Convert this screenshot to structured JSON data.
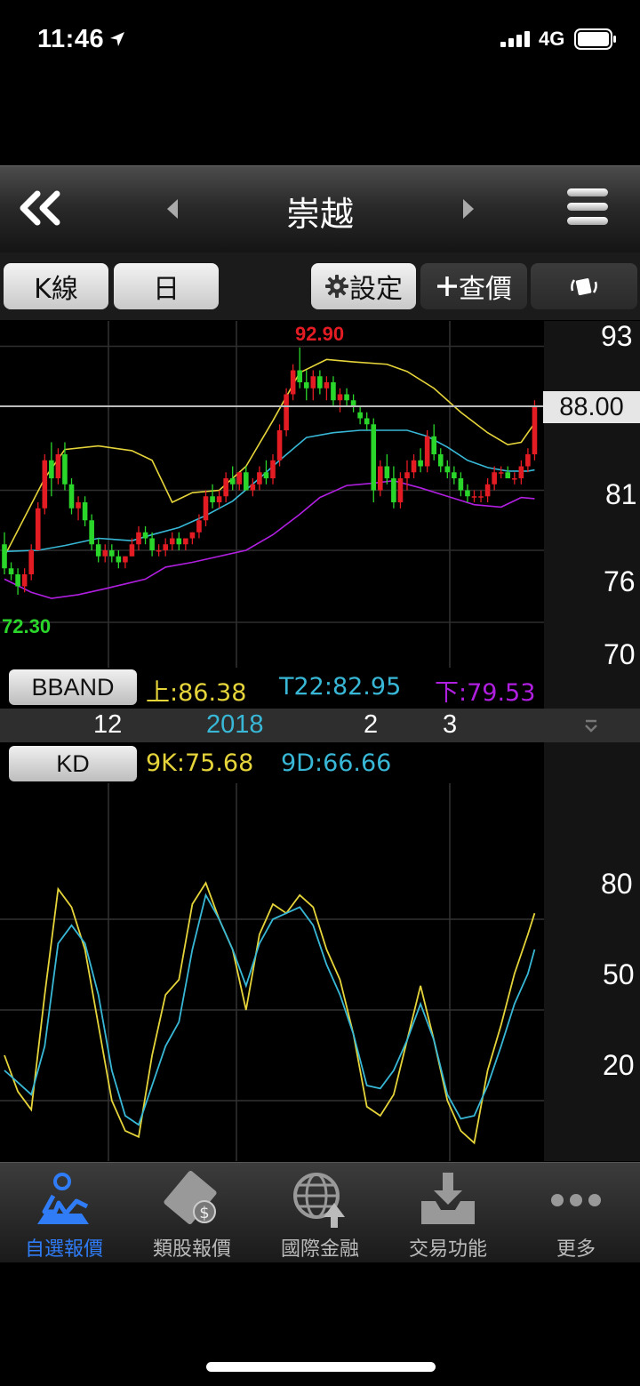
{
  "status": {
    "time": "11:46",
    "network": "4G"
  },
  "nav": {
    "title": "崇越"
  },
  "toolbar": {
    "k_line": "K線",
    "period": "日",
    "settings": "設定",
    "lookup": "查價"
  },
  "price_axis": {
    "ticks": [
      "93",
      "81",
      "76",
      "70"
    ],
    "current": "88.00"
  },
  "kd_axis": {
    "ticks": [
      "80",
      "50",
      "20"
    ]
  },
  "chart_labels": {
    "high": "92.90",
    "low": "72.30"
  },
  "bband": {
    "name": "BBAND",
    "upper": "上:86.38",
    "mid": "T22:82.95",
    "lower": "下:79.53"
  },
  "kd": {
    "name": "KD",
    "k": "9K:75.68",
    "d": "9D:66.66"
  },
  "dates": {
    "d1": "12",
    "d2": "2018",
    "d3": "2",
    "d4": "3"
  },
  "tabs": [
    {
      "label": "自選報價",
      "icon": "watchlist-icon",
      "active": true
    },
    {
      "label": "類股報價",
      "icon": "film-dollar-icon"
    },
    {
      "label": "國際金融",
      "icon": "globe-icon"
    },
    {
      "label": "交易功能",
      "icon": "download-tray-icon"
    },
    {
      "label": "更多",
      "icon": "more-dots-icon"
    }
  ],
  "colors": {
    "up": "#e31c23",
    "down": "#2bd62b",
    "upper_band": "#e5d43a",
    "mid_band": "#38b8d6",
    "lower_band": "#b01fe0",
    "k_line": "#e5d43a",
    "d_line": "#38b8d6",
    "active_tab": "#2f7cf6"
  },
  "chart_data": [
    {
      "type": "candlestick",
      "title": "",
      "y_ticks": [
        70,
        76,
        81,
        93
      ],
      "ylim": [
        69,
        94
      ],
      "x_ticks": [
        "12",
        "2018",
        "2",
        "3"
      ],
      "annotations": {
        "high": 92.9,
        "low": 72.3,
        "last": 88.0
      },
      "ohlc": [
        [
          76.5,
          77.5,
          74.0,
          74.5
        ],
        [
          74.5,
          75.0,
          73.5,
          74.0
        ],
        [
          74.0,
          74.5,
          72.3,
          73.0
        ],
        [
          73.0,
          74.5,
          72.5,
          74.0
        ],
        [
          74.0,
          76.5,
          73.5,
          76.0
        ],
        [
          76.0,
          80.0,
          76.0,
          79.5
        ],
        [
          79.5,
          84.0,
          79.0,
          83.5
        ],
        [
          83.5,
          85.0,
          80.5,
          82.0
        ],
        [
          82.0,
          84.5,
          81.5,
          84.0
        ],
        [
          84.0,
          85.0,
          81.0,
          81.5
        ],
        [
          81.5,
          82.0,
          79.0,
          79.5
        ],
        [
          79.5,
          80.5,
          78.5,
          80.0
        ],
        [
          80.0,
          80.5,
          78.0,
          78.5
        ],
        [
          78.5,
          79.0,
          76.0,
          76.5
        ],
        [
          76.5,
          77.0,
          75.0,
          75.5
        ],
        [
          75.5,
          76.5,
          75.0,
          76.0
        ],
        [
          76.0,
          76.5,
          75.0,
          75.5
        ],
        [
          75.5,
          76.0,
          74.5,
          75.0
        ],
        [
          75.0,
          75.5,
          74.5,
          75.5
        ],
        [
          75.5,
          77.0,
          75.5,
          76.5
        ],
        [
          76.5,
          78.0,
          76.0,
          77.5
        ],
        [
          77.5,
          78.0,
          76.5,
          77.0
        ],
        [
          77.0,
          77.5,
          75.5,
          76.0
        ],
        [
          76.0,
          76.5,
          75.5,
          76.0
        ],
        [
          76.0,
          77.0,
          75.5,
          76.5
        ],
        [
          76.5,
          77.5,
          76.0,
          77.0
        ],
        [
          77.0,
          77.5,
          76.0,
          76.5
        ],
        [
          76.5,
          77.0,
          76.0,
          77.0
        ],
        [
          77.0,
          77.5,
          76.5,
          77.5
        ],
        [
          77.5,
          79.0,
          77.0,
          78.5
        ],
        [
          78.5,
          81.0,
          78.0,
          80.5
        ],
        [
          80.5,
          81.5,
          79.5,
          80.0
        ],
        [
          80.0,
          81.0,
          79.5,
          80.5
        ],
        [
          80.5,
          82.5,
          80.0,
          82.0
        ],
        [
          82.0,
          83.0,
          81.0,
          81.5
        ],
        [
          81.5,
          82.5,
          81.0,
          82.5
        ],
        [
          82.5,
          83.0,
          81.0,
          81.0
        ],
        [
          81.0,
          82.0,
          80.5,
          81.5
        ],
        [
          81.5,
          83.0,
          81.0,
          82.5
        ],
        [
          82.5,
          83.5,
          81.5,
          82.0
        ],
        [
          82.0,
          84.0,
          81.5,
          83.5
        ],
        [
          83.5,
          86.5,
          83.0,
          86.0
        ],
        [
          86.0,
          89.5,
          85.5,
          89.0
        ],
        [
          89.0,
          91.5,
          88.5,
          91.0
        ],
        [
          91.0,
          92.9,
          89.5,
          90.0
        ],
        [
          90.0,
          91.0,
          88.5,
          89.5
        ],
        [
          89.5,
          91.0,
          88.5,
          90.5
        ],
        [
          90.5,
          91.0,
          89.0,
          89.5
        ],
        [
          89.5,
          90.5,
          88.5,
          90.0
        ],
        [
          90.0,
          90.5,
          88.0,
          88.5
        ],
        [
          88.5,
          89.5,
          87.5,
          89.0
        ],
        [
          89.0,
          89.5,
          88.0,
          88.5
        ],
        [
          88.5,
          89.0,
          87.5,
          88.0
        ],
        [
          87.5,
          88.0,
          86.5,
          87.0
        ],
        [
          87.0,
          87.5,
          86.0,
          86.5
        ],
        [
          86.5,
          87.0,
          80.0,
          81.0
        ],
        [
          81.0,
          83.5,
          80.5,
          83.0
        ],
        [
          83.0,
          84.0,
          81.5,
          82.0
        ],
        [
          82.0,
          83.0,
          79.5,
          80.0
        ],
        [
          80.0,
          82.5,
          79.5,
          82.0
        ],
        [
          82.0,
          83.5,
          81.0,
          82.5
        ],
        [
          82.5,
          84.0,
          82.0,
          83.5
        ],
        [
          83.5,
          84.5,
          82.5,
          83.0
        ],
        [
          83.0,
          86.0,
          82.5,
          85.5
        ],
        [
          85.5,
          86.5,
          83.5,
          84.0
        ],
        [
          84.0,
          84.5,
          82.5,
          83.0
        ],
        [
          83.0,
          83.5,
          82.0,
          82.5
        ],
        [
          82.5,
          83.0,
          81.5,
          82.0
        ],
        [
          82.0,
          82.5,
          80.5,
          81.0
        ],
        [
          81.0,
          81.5,
          80.0,
          80.5
        ],
        [
          80.5,
          81.0,
          80.0,
          80.5
        ],
        [
          80.5,
          81.0,
          80.0,
          80.5
        ],
        [
          80.5,
          82.0,
          80.0,
          81.5
        ],
        [
          81.5,
          83.0,
          81.0,
          82.5
        ],
        [
          82.5,
          83.0,
          82.0,
          82.5
        ],
        [
          82.5,
          83.0,
          82.0,
          82.0
        ],
        [
          82.0,
          82.5,
          81.5,
          82.0
        ],
        [
          82.0,
          83.5,
          81.5,
          83.0
        ],
        [
          83.0,
          84.5,
          82.5,
          84.0
        ],
        [
          84.0,
          88.5,
          83.5,
          88.0
        ]
      ],
      "bands": {
        "upper": [
          [
            0,
            75.5
          ],
          [
            6,
            82.0
          ],
          [
            9,
            84.4
          ],
          [
            14,
            84.7
          ],
          [
            19,
            84.3
          ],
          [
            22,
            83.5
          ],
          [
            25,
            80.0
          ],
          [
            28,
            80.8
          ],
          [
            32,
            81.0
          ],
          [
            36,
            83.0
          ],
          [
            40,
            86.8
          ],
          [
            44,
            90.8
          ],
          [
            48,
            91.9
          ],
          [
            52,
            91.7
          ],
          [
            57,
            91.5
          ],
          [
            60,
            90.9
          ],
          [
            64,
            89.5
          ],
          [
            68,
            87.5
          ],
          [
            72,
            85.8
          ],
          [
            75,
            84.8
          ],
          [
            77,
            85.0
          ],
          [
            79,
            86.6
          ]
        ],
        "mid": [
          [
            0,
            75.9
          ],
          [
            5,
            76.0
          ],
          [
            9,
            76.4
          ],
          [
            14,
            77.0
          ],
          [
            19,
            76.8
          ],
          [
            22,
            77.3
          ],
          [
            26,
            77.9
          ],
          [
            30,
            78.9
          ],
          [
            34,
            80.1
          ],
          [
            38,
            82.0
          ],
          [
            41,
            83.5
          ],
          [
            45,
            85.4
          ],
          [
            49,
            85.8
          ],
          [
            53,
            86.0
          ],
          [
            57,
            86.0
          ],
          [
            60,
            86.0
          ],
          [
            63,
            85.5
          ],
          [
            66,
            84.6
          ],
          [
            69,
            83.5
          ],
          [
            72,
            82.9
          ],
          [
            75,
            82.6
          ],
          [
            78,
            82.6
          ],
          [
            79,
            82.7
          ]
        ],
        "lower": [
          [
            0,
            73.6
          ],
          [
            4,
            72.5
          ],
          [
            7,
            72.0
          ],
          [
            11,
            72.3
          ],
          [
            15,
            72.8
          ],
          [
            18,
            73.2
          ],
          [
            21,
            73.6
          ],
          [
            24,
            74.6
          ],
          [
            28,
            75.0
          ],
          [
            32,
            75.5
          ],
          [
            36,
            76.0
          ],
          [
            40,
            77.3
          ],
          [
            44,
            79.0
          ],
          [
            47,
            80.4
          ],
          [
            51,
            81.4
          ],
          [
            55,
            81.6
          ],
          [
            58,
            81.8
          ],
          [
            62,
            81.2
          ],
          [
            66,
            80.5
          ],
          [
            70,
            79.8
          ],
          [
            74,
            79.6
          ],
          [
            77,
            80.4
          ],
          [
            79,
            80.3
          ]
        ]
      }
    },
    {
      "type": "line",
      "title": "",
      "y_ticks": [
        20,
        50,
        80
      ],
      "ylim": [
        0,
        100
      ],
      "series": [
        {
          "name": "9K",
          "points": [
            [
              0,
              35
            ],
            [
              2,
              23
            ],
            [
              4,
              17
            ],
            [
              6,
              55
            ],
            [
              8,
              90
            ],
            [
              10,
              84
            ],
            [
              12,
              70
            ],
            [
              14,
              45
            ],
            [
              16,
              20
            ],
            [
              18,
              10
            ],
            [
              20,
              8
            ],
            [
              22,
              35
            ],
            [
              24,
              55
            ],
            [
              26,
              60
            ],
            [
              28,
              85
            ],
            [
              30,
              92
            ],
            [
              32,
              80
            ],
            [
              34,
              70
            ],
            [
              36,
              50
            ],
            [
              38,
              75
            ],
            [
              40,
              85
            ],
            [
              42,
              82
            ],
            [
              44,
              88
            ],
            [
              46,
              84
            ],
            [
              48,
              70
            ],
            [
              50,
              60
            ],
            [
              52,
              42
            ],
            [
              54,
              18
            ],
            [
              56,
              15
            ],
            [
              58,
              22
            ],
            [
              60,
              40
            ],
            [
              62,
              58
            ],
            [
              64,
              40
            ],
            [
              66,
              20
            ],
            [
              68,
              10
            ],
            [
              70,
              6
            ],
            [
              72,
              30
            ],
            [
              74,
              45
            ],
            [
              76,
              62
            ],
            [
              78,
              75
            ],
            [
              79,
              82
            ]
          ]
        },
        {
          "name": "9D",
          "points": [
            [
              0,
              30
            ],
            [
              2,
              26
            ],
            [
              4,
              22
            ],
            [
              6,
              38
            ],
            [
              8,
              72
            ],
            [
              10,
              78
            ],
            [
              12,
              72
            ],
            [
              14,
              55
            ],
            [
              16,
              30
            ],
            [
              18,
              15
            ],
            [
              20,
              12
            ],
            [
              22,
              25
            ],
            [
              24,
              38
            ],
            [
              26,
              46
            ],
            [
              28,
              70
            ],
            [
              30,
              88
            ],
            [
              32,
              80
            ],
            [
              34,
              70
            ],
            [
              36,
              58
            ],
            [
              38,
              72
            ],
            [
              40,
              80
            ],
            [
              42,
              82
            ],
            [
              44,
              84
            ],
            [
              46,
              78
            ],
            [
              48,
              65
            ],
            [
              50,
              55
            ],
            [
              52,
              42
            ],
            [
              54,
              25
            ],
            [
              56,
              24
            ],
            [
              58,
              30
            ],
            [
              60,
              40
            ],
            [
              62,
              52
            ],
            [
              64,
              40
            ],
            [
              66,
              22
            ],
            [
              68,
              14
            ],
            [
              70,
              15
            ],
            [
              72,
              25
            ],
            [
              74,
              38
            ],
            [
              76,
              52
            ],
            [
              78,
              62
            ],
            [
              79,
              70
            ]
          ]
        }
      ]
    }
  ]
}
